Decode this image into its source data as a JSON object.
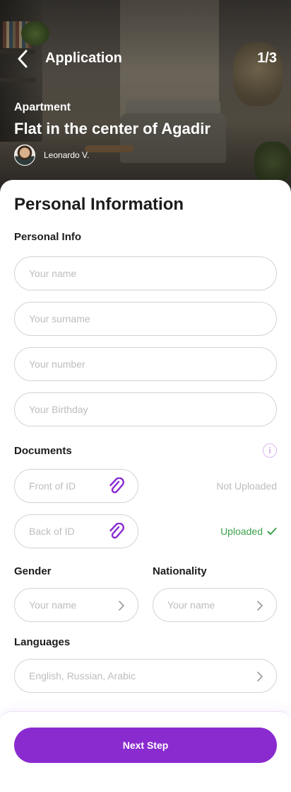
{
  "header": {
    "title": "Application",
    "step_counter": "1/3",
    "back_icon": "chevron-left-icon"
  },
  "listing": {
    "category": "Apartment",
    "title": "Flat in the center of Agadir",
    "host_name": "Leonardo V."
  },
  "form": {
    "section_title": "Personal Information",
    "personal_info": {
      "label": "Personal Info",
      "name_placeholder": "Your name",
      "surname_placeholder": "Your surname",
      "number_placeholder": "Your number",
      "birthday_placeholder": "Your Birthday"
    },
    "documents": {
      "label": "Documents",
      "info_icon": "info-icon",
      "front": {
        "label": "Front of ID",
        "status": "Not Uploaded",
        "uploaded": false
      },
      "back": {
        "label": "Back of ID",
        "status": "Uploaded",
        "uploaded": true
      }
    },
    "gender": {
      "label": "Gender",
      "placeholder": "Your name"
    },
    "nationality": {
      "label": "Nationality",
      "placeholder": "Your name"
    },
    "languages": {
      "label": "Languages",
      "placeholder": "English, Russian, Arabic"
    }
  },
  "footer": {
    "next_label": "Next Step"
  },
  "colors": {
    "accent": "#8a2bd0",
    "success": "#3aa14a",
    "placeholder": "#bdbdbd",
    "border": "#d3d3d3"
  }
}
